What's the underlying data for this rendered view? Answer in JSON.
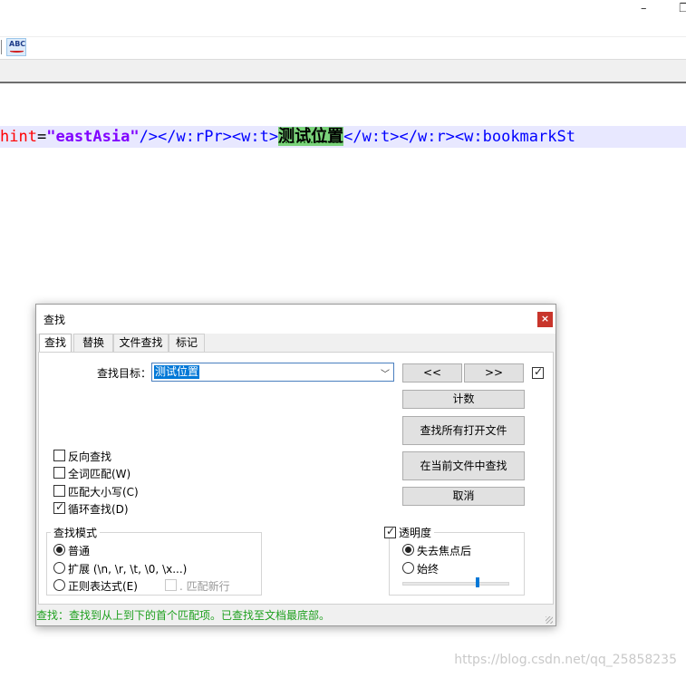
{
  "window": {
    "minimize_glyph": "–",
    "restore_glyph": "❐"
  },
  "toolbar": {
    "spell_icon_text": "ABC"
  },
  "editor": {
    "line": [
      {
        "cls": "tok-attr",
        "text": "hint"
      },
      {
        "cls": "tok-eq",
        "text": "="
      },
      {
        "cls": "tok-str",
        "text": "\"eastAsia\""
      },
      {
        "cls": "tok-tag",
        "text": "/></w:rPr><w:t>"
      },
      {
        "cls": "tok-hl",
        "text": "测试位置"
      },
      {
        "cls": "tok-tag",
        "text": "</w:t></w:r><w:bookmarkSt"
      }
    ]
  },
  "dialog": {
    "title": "查找",
    "close": "×",
    "tabs": [
      "查找",
      "替换",
      "文件查找",
      "标记"
    ],
    "find_label": "查找目标：",
    "find_value": "测试位置",
    "prev_button": "<<",
    "next_button": ">>",
    "count_button": "计数",
    "find_all_open_button": "查找所有打开文件",
    "find_in_current_button": "在当前文件中查找",
    "cancel_button": "取消",
    "options": {
      "reverse": {
        "label": "反向查找",
        "checked": false
      },
      "whole_word": {
        "label": "全词匹配(W)",
        "checked": false
      },
      "match_case": {
        "label": "匹配大小写(C)",
        "checked": false
      },
      "wrap": {
        "label": "循环查找(D)",
        "checked": true
      }
    },
    "search_mode": {
      "title": "查找模式",
      "normal": "普通",
      "extended": "扩展 (\\n, \\r, \\t, \\0, \\x...)",
      "regex": "正则表达式(E)",
      "dot_newline": ". 匹配新行",
      "selected": "normal"
    },
    "transparency": {
      "title": "透明度",
      "enabled": true,
      "on_lose_focus": "失去焦点后",
      "always": "始终",
      "selected": "on_lose_focus",
      "level_fraction": 0.7
    },
    "status": "查找：查找到从上到下的首个匹配项。已查找至文档最底部。"
  },
  "watermark": "https://blog.csdn.net/qq_25858235",
  "colors": {
    "accent": "#0078d7",
    "status_green": "#1ea01e",
    "highlight": "#7ad27a"
  }
}
